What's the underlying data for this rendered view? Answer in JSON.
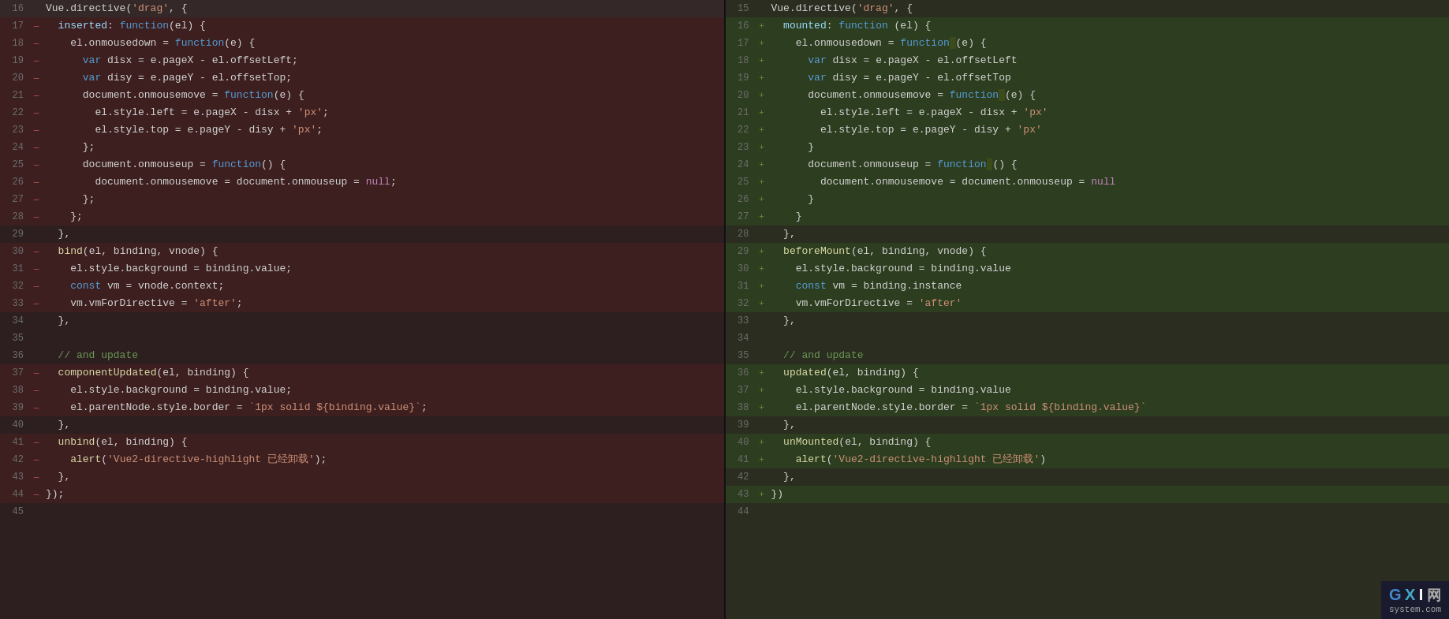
{
  "left": {
    "lines": [
      {
        "num": "16",
        "marker": "",
        "code": "Vue.directive(<span class='str'>'drag'</span>, {",
        "cls": "neutral-left"
      },
      {
        "num": "17",
        "marker": "—",
        "code": "  <span class='prop'>inserted</span>: <span class='func-kw'>function</span>(el) {",
        "cls": "removed"
      },
      {
        "num": "18",
        "marker": "—",
        "code": "    el.onmousedown = <span class='func-kw'>function</span>(e) {",
        "cls": "removed"
      },
      {
        "num": "19",
        "marker": "—",
        "code": "      <span class='func-kw'>var</span> disx = e.pageX - el.offsetLeft;",
        "cls": "removed"
      },
      {
        "num": "20",
        "marker": "—",
        "code": "      <span class='func-kw'>var</span> disy = e.pageY - el.offsetTop;",
        "cls": "removed"
      },
      {
        "num": "21",
        "marker": "—",
        "code": "      document.onmousemove = <span class='func-kw'>function</span>(e) {",
        "cls": "removed"
      },
      {
        "num": "22",
        "marker": "—",
        "code": "        el.style.left = e.pageX - disx + <span class='str'>'px'</span>;",
        "cls": "removed"
      },
      {
        "num": "23",
        "marker": "—",
        "code": "        el.style.top = e.pageY - disy + <span class='str'>'px'</span>;",
        "cls": "removed"
      },
      {
        "num": "24",
        "marker": "—",
        "code": "      };",
        "cls": "removed"
      },
      {
        "num": "25",
        "marker": "—",
        "code": "      document.onmouseup = <span class='func-kw'>function</span>() {",
        "cls": "removed"
      },
      {
        "num": "26",
        "marker": "—",
        "code": "        document.onmousemove = document.onmouseup = <span class='kw'>null</span>;",
        "cls": "removed"
      },
      {
        "num": "27",
        "marker": "—",
        "code": "      };",
        "cls": "removed"
      },
      {
        "num": "28",
        "marker": "—",
        "code": "    };",
        "cls": "removed"
      },
      {
        "num": "29",
        "marker": "",
        "code": "  },",
        "cls": "neutral-left"
      },
      {
        "num": "30",
        "marker": "—",
        "code": "  <span class='fn'>bind</span>(el, binding, vnode) {",
        "cls": "removed"
      },
      {
        "num": "31",
        "marker": "—",
        "code": "    el.style.background = binding.value;",
        "cls": "removed"
      },
      {
        "num": "32",
        "marker": "—",
        "code": "    <span class='func-kw'>const</span> vm = vnode.context;",
        "cls": "removed"
      },
      {
        "num": "33",
        "marker": "—",
        "code": "    vm.vmForDirective = <span class='str'>'after'</span>;",
        "cls": "removed"
      },
      {
        "num": "34",
        "marker": "",
        "code": "  },",
        "cls": "neutral-left"
      },
      {
        "num": "35",
        "marker": "",
        "code": "",
        "cls": "neutral-left"
      },
      {
        "num": "36",
        "marker": "",
        "code": "  <span class='cm'>// and update</span>",
        "cls": "neutral-left"
      },
      {
        "num": "37",
        "marker": "—",
        "code": "  <span class='fn'>componentUpdated</span>(el, binding) {",
        "cls": "removed"
      },
      {
        "num": "38",
        "marker": "—",
        "code": "    el.style.background = binding.value;",
        "cls": "removed"
      },
      {
        "num": "39",
        "marker": "—",
        "code": "    el.parentNode.style.border = <span class='str'>`1px solid ${binding.value}`</span>;",
        "cls": "removed"
      },
      {
        "num": "40",
        "marker": "",
        "code": "  },",
        "cls": "neutral-left"
      },
      {
        "num": "41",
        "marker": "—",
        "code": "  <span class='fn'>unbind</span>(el, binding) {",
        "cls": "removed"
      },
      {
        "num": "42",
        "marker": "—",
        "code": "    <span class='fn'>alert</span>(<span class='str'>'Vue2-directive-highlight 已经卸载'</span>);",
        "cls": "removed"
      },
      {
        "num": "43",
        "marker": "—",
        "code": "  },",
        "cls": "removed"
      },
      {
        "num": "44",
        "marker": "—",
        "code": "});",
        "cls": "removed"
      },
      {
        "num": "45",
        "marker": "",
        "code": "",
        "cls": "neutral-left"
      }
    ]
  },
  "right": {
    "lines": [
      {
        "num": "15",
        "marker": "",
        "code": "Vue.directive(<span class='str'>'drag'</span>, {",
        "cls": "neutral-right"
      },
      {
        "num": "16",
        "marker": "+",
        "code": "  <span class='prop'>mounted</span>: <span class='func-kw'>function</span> (el) {",
        "cls": "added"
      },
      {
        "num": "17",
        "marker": "+",
        "code": "    el.onmousedown = <span class='func-kw'>function</span><span class='highlight-fn'> </span>(e) {",
        "cls": "added"
      },
      {
        "num": "18",
        "marker": "+",
        "code": "      <span class='func-kw'>var</span> disx = e.pageX - el.offsetLeft",
        "cls": "added"
      },
      {
        "num": "19",
        "marker": "+",
        "code": "      <span class='func-kw'>var</span> disy = e.pageY - el.offsetTop",
        "cls": "added"
      },
      {
        "num": "20",
        "marker": "+",
        "code": "      document.onmousemove = <span class='func-kw'>function</span><span class='highlight-fn'> </span>(e) {",
        "cls": "added"
      },
      {
        "num": "21",
        "marker": "+",
        "code": "        el.style.left = e.pageX - disx + <span class='str'>'px'</span>",
        "cls": "added"
      },
      {
        "num": "22",
        "marker": "+",
        "code": "        el.style.top = e.pageY - disy + <span class='str'>'px'</span>",
        "cls": "added"
      },
      {
        "num": "23",
        "marker": "+",
        "code": "      }",
        "cls": "added"
      },
      {
        "num": "24",
        "marker": "+",
        "code": "      document.onmouseup = <span class='func-kw'>function</span><span class='highlight-fn'> </span>() {",
        "cls": "added"
      },
      {
        "num": "25",
        "marker": "+",
        "code": "        document.onmousemove = document.onmouseup = <span class='kw'>null</span>",
        "cls": "added"
      },
      {
        "num": "26",
        "marker": "+",
        "code": "      }",
        "cls": "added"
      },
      {
        "num": "27",
        "marker": "+",
        "code": "    }",
        "cls": "added"
      },
      {
        "num": "28",
        "marker": "",
        "code": "  },",
        "cls": "neutral-right"
      },
      {
        "num": "29",
        "marker": "+",
        "code": "  <span class='fn'>beforeMount</span>(el, binding, vnode) {",
        "cls": "added"
      },
      {
        "num": "30",
        "marker": "+",
        "code": "    el.style.background = binding.value",
        "cls": "added"
      },
      {
        "num": "31",
        "marker": "+",
        "code": "    <span class='func-kw'>const</span> vm = binding.instance",
        "cls": "added"
      },
      {
        "num": "32",
        "marker": "+",
        "code": "    vm.vmForDirective = <span class='str'>'after'</span>",
        "cls": "added"
      },
      {
        "num": "33",
        "marker": "",
        "code": "  },",
        "cls": "neutral-right"
      },
      {
        "num": "34",
        "marker": "",
        "code": "",
        "cls": "neutral-right"
      },
      {
        "num": "35",
        "marker": "",
        "code": "  <span class='cm'>// and update</span>",
        "cls": "neutral-right"
      },
      {
        "num": "36",
        "marker": "+",
        "code": "  <span class='fn'>updated</span>(el, binding) {",
        "cls": "added"
      },
      {
        "num": "37",
        "marker": "+",
        "code": "    el.style.background = binding.value",
        "cls": "added"
      },
      {
        "num": "38",
        "marker": "+",
        "code": "    el.parentNode.style.border = <span class='str'>`1px solid ${binding.value}`</span>",
        "cls": "added"
      },
      {
        "num": "39",
        "marker": "",
        "code": "  },",
        "cls": "neutral-right"
      },
      {
        "num": "40",
        "marker": "+",
        "code": "  <span class='fn'>unMounted</span>(el, binding) {",
        "cls": "added"
      },
      {
        "num": "41",
        "marker": "+",
        "code": "    <span class='fn'>alert</span>(<span class='str'>'Vue2-directive-highlight 已经卸载'</span>)",
        "cls": "added"
      },
      {
        "num": "42",
        "marker": "",
        "code": "  },",
        "cls": "neutral-right"
      },
      {
        "num": "43",
        "marker": "+",
        "code": "})",
        "cls": "added"
      },
      {
        "num": "44",
        "marker": "",
        "code": "",
        "cls": "neutral-right"
      }
    ]
  },
  "watermark": {
    "g": "G",
    "x": "X",
    "i": "I",
    "slash": "/",
    "site": "system.com"
  }
}
